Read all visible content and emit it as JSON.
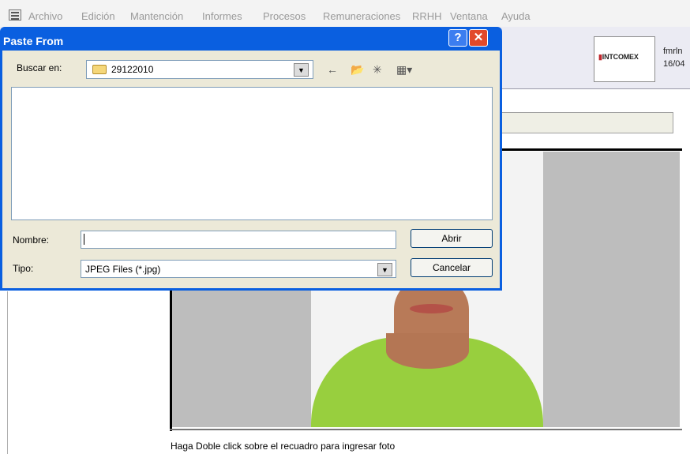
{
  "menubar": {
    "items": [
      "Archivo",
      "Edición",
      "Mantención",
      "Informes",
      "Procesos",
      "Remuneraciones",
      "RRHH",
      "Ventana",
      "Ayuda"
    ]
  },
  "header": {
    "logo": "INTCOMEX",
    "user": "fmrln",
    "date": "16/04"
  },
  "dialog": {
    "title": "Paste From",
    "help": "?",
    "close": "✕",
    "lookin_label": "Buscar en:",
    "folder": "29122010",
    "name_label": "Nombre:",
    "name_value": "",
    "type_label": "Tipo:",
    "type_value": "JPEG Files (*.jpg)",
    "open_label": "Abrir",
    "cancel_label": "Cancelar"
  },
  "photo": {
    "hint": "Haga Doble click sobre el recuadro para ingresar foto"
  }
}
